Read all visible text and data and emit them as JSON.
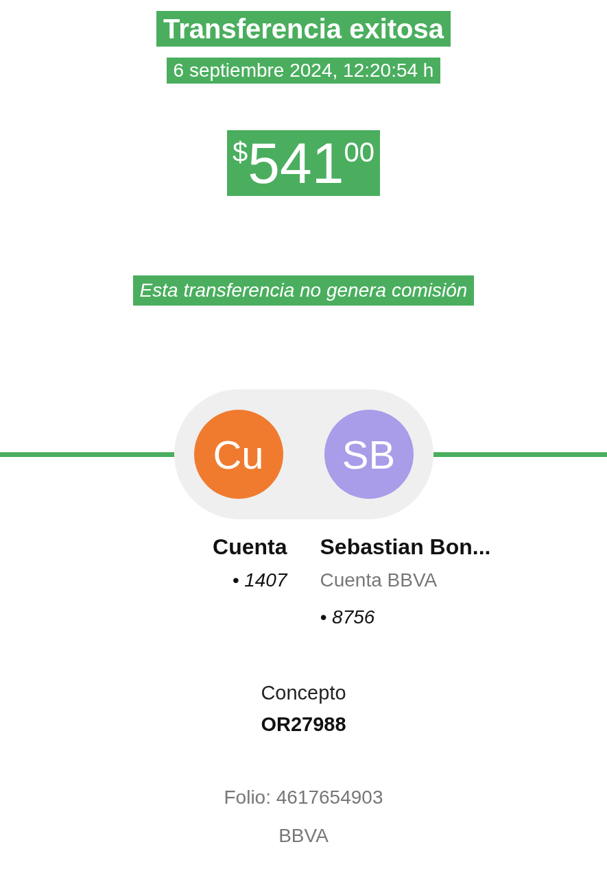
{
  "header": {
    "title": "Transferencia exitosa",
    "date": "6 septiembre 2024, 12:20:54 h"
  },
  "amount": {
    "currency": "$",
    "integer": "541",
    "cents": "00"
  },
  "note": "Esta transferencia no genera comisión",
  "parties": [
    {
      "initials": "Cu",
      "color": "#f07b2f",
      "name": "Cuenta",
      "lines": [
        "• 1407"
      ]
    },
    {
      "initials": "SB",
      "color": "#a99ce8",
      "name": "Sebastian Bon...",
      "lines": [
        "Cuenta BBVA",
        "• 8756"
      ]
    }
  ],
  "concept": {
    "label": "Concepto",
    "value": "OR27988"
  },
  "folio": "Folio: 4617654903",
  "bank": "BBVA"
}
